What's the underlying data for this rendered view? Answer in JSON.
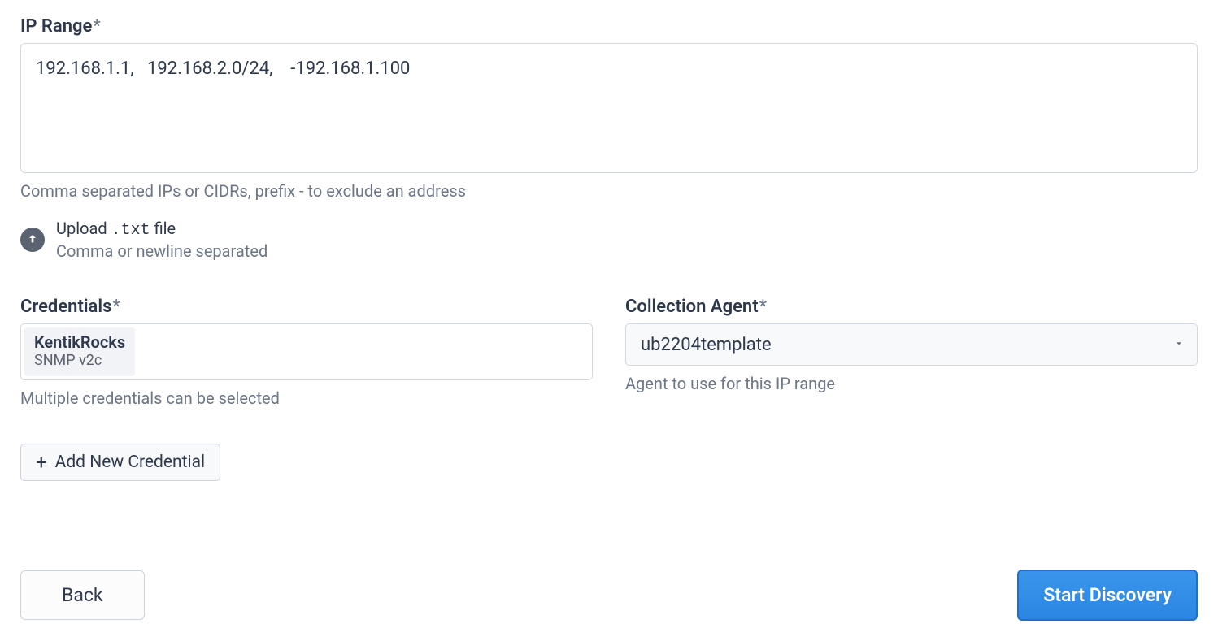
{
  "ip_range": {
    "label": "IP Range",
    "required_marker": "*",
    "value": "192.168.1.1,   192.168.2.0/24,    -192.168.1.100",
    "hint": "Comma separated IPs or CIDRs, prefix - to exclude an address"
  },
  "upload": {
    "title_pre": "Upload ",
    "title_mono": ".txt",
    "title_post": " file",
    "subtitle": "Comma or newline separated"
  },
  "credentials": {
    "label": "Credentials",
    "required_marker": "*",
    "chips": [
      {
        "title": "KentikRocks",
        "sub": "SNMP v2c"
      }
    ],
    "hint": "Multiple credentials can be selected",
    "add_label": "Add New Credential"
  },
  "collection_agent": {
    "label": "Collection Agent",
    "required_marker": "*",
    "selected": "ub2204template",
    "hint": "Agent to use for this IP range"
  },
  "footer": {
    "back": "Back",
    "start": "Start Discovery"
  }
}
